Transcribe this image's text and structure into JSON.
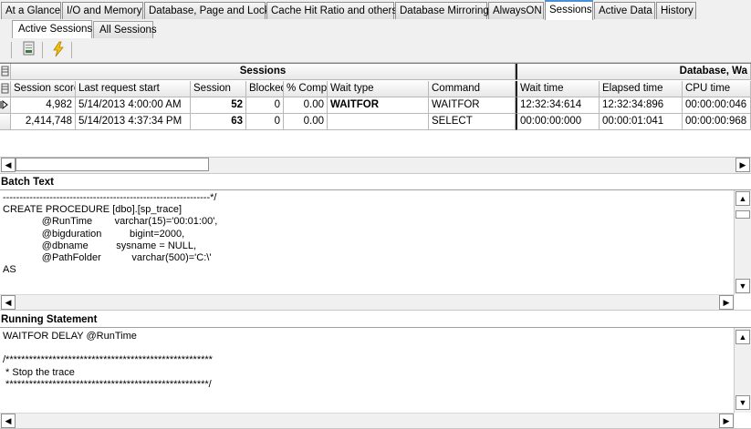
{
  "tabs": [
    "At a Glance",
    "I/O and Memory",
    "Database, Page and Lock",
    "Cache Hit Ratio and others",
    "Database Mirroring",
    "AlwaysON",
    "Sessions",
    "Active Data",
    "History"
  ],
  "active_tab": "Sessions",
  "subtabs": [
    "Active Sessions",
    "All Sessions"
  ],
  "grid": {
    "band_sessions": "Sessions",
    "band_database": "Database, Wa",
    "columns": [
      "Session score",
      "Last request start",
      "Session",
      "Blocked",
      "% Compl",
      "Wait type",
      "Command",
      "Wait time",
      "Elapsed time",
      "CPU time"
    ],
    "rows": [
      {
        "score": "4,982",
        "last_request": "5/14/2013 4:00:00 AM",
        "session": "52",
        "blocked": "0",
        "pct": "0.00",
        "wait_type": "WAITFOR",
        "command": "WAITFOR",
        "wait_time": "12:32:34:614",
        "elapsed": "12:32:34:896",
        "cpu": "00:00:00:046"
      },
      {
        "score": "2,414,748",
        "last_request": "5/14/2013 4:37:34 PM",
        "session": "63",
        "blocked": "0",
        "pct": "0.00",
        "wait_type": "",
        "command": "SELECT",
        "wait_time": "00:00:00:000",
        "elapsed": "00:00:01:041",
        "cpu": "00:00:00:968"
      }
    ]
  },
  "batch": {
    "title": "Batch Text",
    "text": "--------------------------------------------------------------*/\nCREATE PROCEDURE [dbo].[sp_trace]\n              @RunTime        varchar(15)='00:01:00',\n              @bigduration          bigint=2000,\n              @dbname          sysname = NULL,\n              @PathFolder           varchar(500)='C:\\'\nAS"
  },
  "running": {
    "title": "Running Statement",
    "text": "WAITFOR DELAY @RunTime\n\n/*****************************************************\n * Stop the trace\n ****************************************************/"
  },
  "icons": [
    "excel-export-icon",
    "lightning-icon",
    "grid-selector-icon",
    "row-indicator-icon"
  ],
  "colors": {
    "tab_accent": "#4a90d9",
    "lightning": "#f4c20d"
  }
}
